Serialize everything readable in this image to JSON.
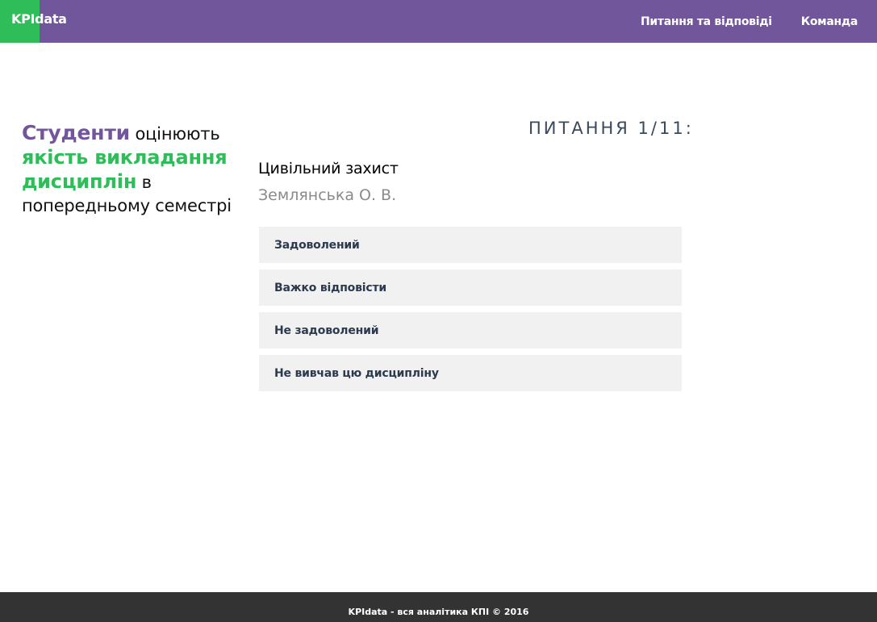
{
  "colors": {
    "navbar": "#71569b",
    "logo_block": "#2ebd59",
    "accent_green": "#2ebd59",
    "accent_purple": "#71569b",
    "answer_bg": "#f1f1f1",
    "footer_bg": "#333333"
  },
  "navbar": {
    "logo": "KPIdata",
    "links": [
      {
        "label": "Питання та відповіді"
      },
      {
        "label": "Команда"
      }
    ]
  },
  "tagline": {
    "part1": "Студенти",
    "part2": " оцінюють ",
    "part3": "якість викладання дисциплін",
    "part4": " в попередньому семестрі"
  },
  "question": {
    "counter": "ПИТАННЯ 1/11:",
    "subject": "Цивільний захист",
    "teacher": "Землянська О. В.",
    "answers": [
      {
        "label": "Задоволений"
      },
      {
        "label": "Важко відповісти"
      },
      {
        "label": "Не задоволений"
      },
      {
        "label": "Не вивчав цю дисципліну"
      }
    ]
  },
  "footer": {
    "text": "KPIdata - вся аналітика КПІ © 2016"
  }
}
